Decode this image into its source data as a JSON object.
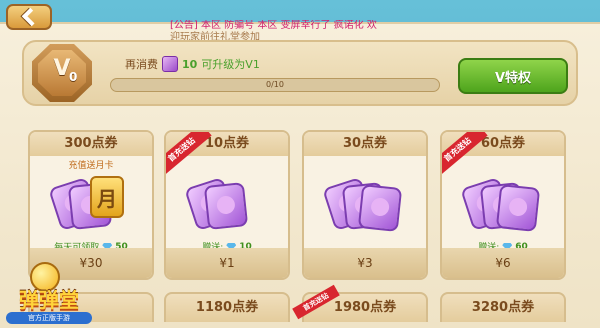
{
  "ticker": {
    "line1": "[公告] 本区 防骗号 本区 变屏幸行了 疯诺化 欢",
    "line2": "迎玩家前往礼堂参加"
  },
  "vip": {
    "badge_letter": "V",
    "badge_level": "0",
    "spend_prefix": "再消费",
    "spend_amount": "10",
    "spend_suffix": "可升级为V1",
    "progress_text": "0/10",
    "progress_fraction": 0,
    "button_label": "V特权"
  },
  "cards": [
    {
      "title": "300点券",
      "subtitle": "充值送月卡",
      "badge_char": "月",
      "bonus_label": "每天可领取",
      "bonus_value": "50",
      "price": "¥30"
    },
    {
      "title": "10点券",
      "ribbon": "首充送钻",
      "bonus_label": "赠送:",
      "bonus_value": "10",
      "price": "¥1"
    },
    {
      "title": "30点券",
      "price": "¥3"
    },
    {
      "title": "60点券",
      "ribbon": "首充送钻",
      "bonus_label": "赠送:",
      "bonus_value": "60",
      "price": "¥6"
    }
  ],
  "row2": [
    {
      "title": ""
    },
    {
      "title": "1180点券"
    },
    {
      "title": "1980点券",
      "ribbon": "首充送钻"
    },
    {
      "title": "3280点券"
    }
  ],
  "logo": {
    "name": "弹弹堂",
    "tagline": "官方正版手游"
  },
  "colors": {
    "accent_green": "#4ea41c",
    "ribbon_red": "#d8262f",
    "panel_beige": "#f7efdb"
  }
}
